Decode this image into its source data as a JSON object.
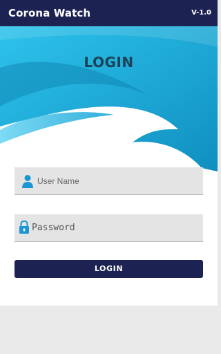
{
  "app": {
    "title": "Corona Watch",
    "version": "V-1.0"
  },
  "login": {
    "heading": "LOGIN",
    "username_placeholder": "User Name",
    "password_placeholder": "Password",
    "button_label": "LOGIN"
  },
  "colors": {
    "primary": "#1c2251",
    "accent": "#1aa8d8",
    "heading": "#1a4357",
    "field_bg": "#e4e4e4"
  },
  "icons": {
    "username": "user-icon",
    "password": "lock-icon"
  }
}
